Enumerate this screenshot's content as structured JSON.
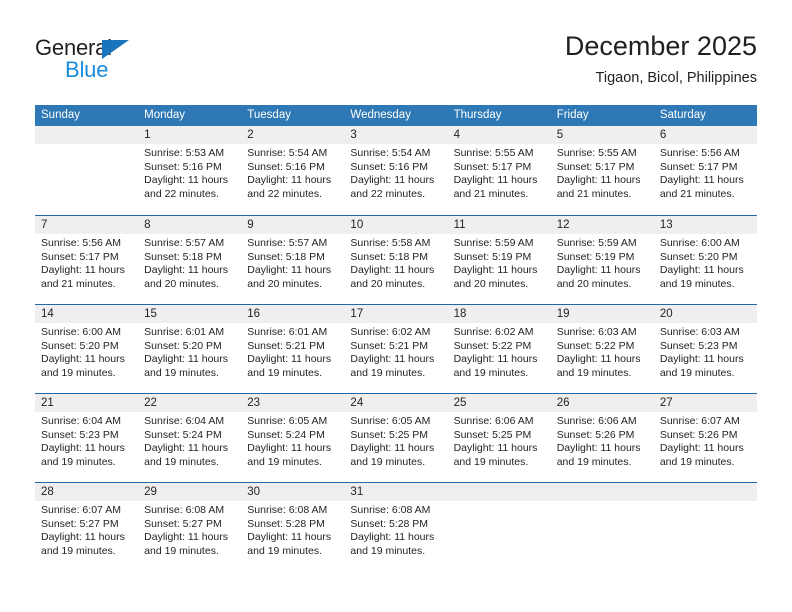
{
  "brand": {
    "name_part1": "General",
    "name_part2": "Blue",
    "triangle_color": "#1a74bb",
    "blue_color": "#1a8cdb"
  },
  "header": {
    "title": "December 2025",
    "subtitle": "Tigaon, Bicol, Philippines"
  },
  "colors": {
    "header_row_bg": "#2e79b5",
    "week_divider": "#1f69ab",
    "day_number_bg": "#efefef",
    "text": "#231f20"
  },
  "weekdays": [
    "Sunday",
    "Monday",
    "Tuesday",
    "Wednesday",
    "Thursday",
    "Friday",
    "Saturday"
  ],
  "weeks": [
    [
      {
        "day": "",
        "empty": true
      },
      {
        "day": "1",
        "sunrise": "Sunrise: 5:53 AM",
        "sunset": "Sunset: 5:16 PM",
        "daylight1": "Daylight: 11 hours",
        "daylight2": "and 22 minutes."
      },
      {
        "day": "2",
        "sunrise": "Sunrise: 5:54 AM",
        "sunset": "Sunset: 5:16 PM",
        "daylight1": "Daylight: 11 hours",
        "daylight2": "and 22 minutes."
      },
      {
        "day": "3",
        "sunrise": "Sunrise: 5:54 AM",
        "sunset": "Sunset: 5:16 PM",
        "daylight1": "Daylight: 11 hours",
        "daylight2": "and 22 minutes."
      },
      {
        "day": "4",
        "sunrise": "Sunrise: 5:55 AM",
        "sunset": "Sunset: 5:17 PM",
        "daylight1": "Daylight: 11 hours",
        "daylight2": "and 21 minutes."
      },
      {
        "day": "5",
        "sunrise": "Sunrise: 5:55 AM",
        "sunset": "Sunset: 5:17 PM",
        "daylight1": "Daylight: 11 hours",
        "daylight2": "and 21 minutes."
      },
      {
        "day": "6",
        "sunrise": "Sunrise: 5:56 AM",
        "sunset": "Sunset: 5:17 PM",
        "daylight1": "Daylight: 11 hours",
        "daylight2": "and 21 minutes."
      }
    ],
    [
      {
        "day": "7",
        "sunrise": "Sunrise: 5:56 AM",
        "sunset": "Sunset: 5:17 PM",
        "daylight1": "Daylight: 11 hours",
        "daylight2": "and 21 minutes."
      },
      {
        "day": "8",
        "sunrise": "Sunrise: 5:57 AM",
        "sunset": "Sunset: 5:18 PM",
        "daylight1": "Daylight: 11 hours",
        "daylight2": "and 20 minutes."
      },
      {
        "day": "9",
        "sunrise": "Sunrise: 5:57 AM",
        "sunset": "Sunset: 5:18 PM",
        "daylight1": "Daylight: 11 hours",
        "daylight2": "and 20 minutes."
      },
      {
        "day": "10",
        "sunrise": "Sunrise: 5:58 AM",
        "sunset": "Sunset: 5:18 PM",
        "daylight1": "Daylight: 11 hours",
        "daylight2": "and 20 minutes."
      },
      {
        "day": "11",
        "sunrise": "Sunrise: 5:59 AM",
        "sunset": "Sunset: 5:19 PM",
        "daylight1": "Daylight: 11 hours",
        "daylight2": "and 20 minutes."
      },
      {
        "day": "12",
        "sunrise": "Sunrise: 5:59 AM",
        "sunset": "Sunset: 5:19 PM",
        "daylight1": "Daylight: 11 hours",
        "daylight2": "and 20 minutes."
      },
      {
        "day": "13",
        "sunrise": "Sunrise: 6:00 AM",
        "sunset": "Sunset: 5:20 PM",
        "daylight1": "Daylight: 11 hours",
        "daylight2": "and 19 minutes."
      }
    ],
    [
      {
        "day": "14",
        "sunrise": "Sunrise: 6:00 AM",
        "sunset": "Sunset: 5:20 PM",
        "daylight1": "Daylight: 11 hours",
        "daylight2": "and 19 minutes."
      },
      {
        "day": "15",
        "sunrise": "Sunrise: 6:01 AM",
        "sunset": "Sunset: 5:20 PM",
        "daylight1": "Daylight: 11 hours",
        "daylight2": "and 19 minutes."
      },
      {
        "day": "16",
        "sunrise": "Sunrise: 6:01 AM",
        "sunset": "Sunset: 5:21 PM",
        "daylight1": "Daylight: 11 hours",
        "daylight2": "and 19 minutes."
      },
      {
        "day": "17",
        "sunrise": "Sunrise: 6:02 AM",
        "sunset": "Sunset: 5:21 PM",
        "daylight1": "Daylight: 11 hours",
        "daylight2": "and 19 minutes."
      },
      {
        "day": "18",
        "sunrise": "Sunrise: 6:02 AM",
        "sunset": "Sunset: 5:22 PM",
        "daylight1": "Daylight: 11 hours",
        "daylight2": "and 19 minutes."
      },
      {
        "day": "19",
        "sunrise": "Sunrise: 6:03 AM",
        "sunset": "Sunset: 5:22 PM",
        "daylight1": "Daylight: 11 hours",
        "daylight2": "and 19 minutes."
      },
      {
        "day": "20",
        "sunrise": "Sunrise: 6:03 AM",
        "sunset": "Sunset: 5:23 PM",
        "daylight1": "Daylight: 11 hours",
        "daylight2": "and 19 minutes."
      }
    ],
    [
      {
        "day": "21",
        "sunrise": "Sunrise: 6:04 AM",
        "sunset": "Sunset: 5:23 PM",
        "daylight1": "Daylight: 11 hours",
        "daylight2": "and 19 minutes."
      },
      {
        "day": "22",
        "sunrise": "Sunrise: 6:04 AM",
        "sunset": "Sunset: 5:24 PM",
        "daylight1": "Daylight: 11 hours",
        "daylight2": "and 19 minutes."
      },
      {
        "day": "23",
        "sunrise": "Sunrise: 6:05 AM",
        "sunset": "Sunset: 5:24 PM",
        "daylight1": "Daylight: 11 hours",
        "daylight2": "and 19 minutes."
      },
      {
        "day": "24",
        "sunrise": "Sunrise: 6:05 AM",
        "sunset": "Sunset: 5:25 PM",
        "daylight1": "Daylight: 11 hours",
        "daylight2": "and 19 minutes."
      },
      {
        "day": "25",
        "sunrise": "Sunrise: 6:06 AM",
        "sunset": "Sunset: 5:25 PM",
        "daylight1": "Daylight: 11 hours",
        "daylight2": "and 19 minutes."
      },
      {
        "day": "26",
        "sunrise": "Sunrise: 6:06 AM",
        "sunset": "Sunset: 5:26 PM",
        "daylight1": "Daylight: 11 hours",
        "daylight2": "and 19 minutes."
      },
      {
        "day": "27",
        "sunrise": "Sunrise: 6:07 AM",
        "sunset": "Sunset: 5:26 PM",
        "daylight1": "Daylight: 11 hours",
        "daylight2": "and 19 minutes."
      }
    ],
    [
      {
        "day": "28",
        "sunrise": "Sunrise: 6:07 AM",
        "sunset": "Sunset: 5:27 PM",
        "daylight1": "Daylight: 11 hours",
        "daylight2": "and 19 minutes."
      },
      {
        "day": "29",
        "sunrise": "Sunrise: 6:08 AM",
        "sunset": "Sunset: 5:27 PM",
        "daylight1": "Daylight: 11 hours",
        "daylight2": "and 19 minutes."
      },
      {
        "day": "30",
        "sunrise": "Sunrise: 6:08 AM",
        "sunset": "Sunset: 5:28 PM",
        "daylight1": "Daylight: 11 hours",
        "daylight2": "and 19 minutes."
      },
      {
        "day": "31",
        "sunrise": "Sunrise: 6:08 AM",
        "sunset": "Sunset: 5:28 PM",
        "daylight1": "Daylight: 11 hours",
        "daylight2": "and 19 minutes."
      },
      {
        "day": "",
        "empty": true
      },
      {
        "day": "",
        "empty": true
      },
      {
        "day": "",
        "empty": true
      }
    ]
  ]
}
